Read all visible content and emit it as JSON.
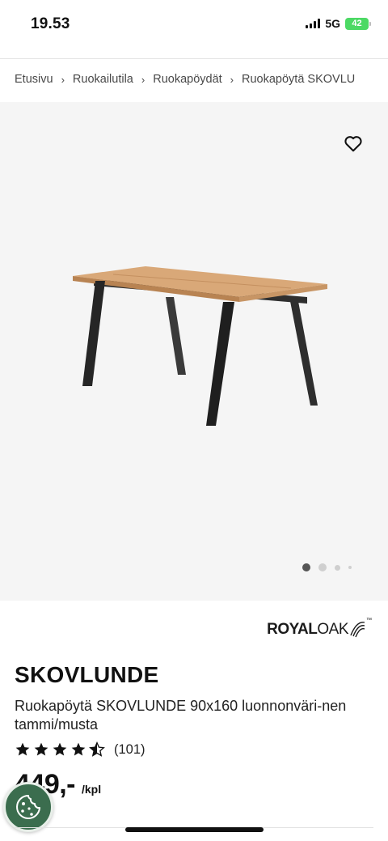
{
  "status_bar": {
    "time": "19.53",
    "network": "5G",
    "battery": "42"
  },
  "breadcrumb": {
    "items": [
      "Etusivu",
      "Ruokailutila",
      "Ruokapöydät",
      "Ruokapöytä SKOVLU"
    ]
  },
  "gallery": {
    "image_count": 4,
    "active_index": 0,
    "favorite_icon": "heart-outline-icon"
  },
  "brand": {
    "part1": "ROYAL",
    "part2": "OAK",
    "mark": "™"
  },
  "product": {
    "name": "SKOVLUNDE",
    "description": "Ruokapöytä SKOVLUNDE 90x160 luonnonväri-nen tammi/musta",
    "rating": 4.5,
    "rating_count": "(101)",
    "price": "449,-",
    "price_unit": "/kpl"
  },
  "cookie_button": {
    "icon": "cookie-icon",
    "color": "#3b6d4e"
  }
}
